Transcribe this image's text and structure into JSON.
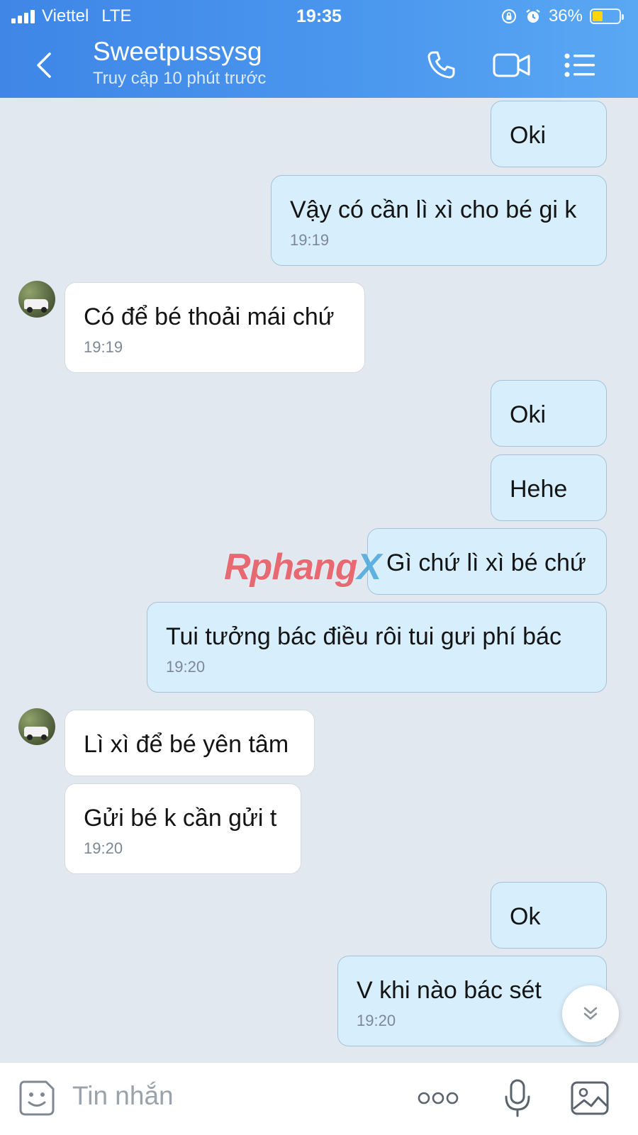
{
  "status_bar": {
    "carrier": "Viettel",
    "network": "LTE",
    "time": "19:35",
    "battery": "36%"
  },
  "header": {
    "contact_name": "Sweetpussysg",
    "last_seen": "Truy cập 10 phút trước"
  },
  "messages": [
    {
      "direction": "sent",
      "text": "Oki",
      "time": ""
    },
    {
      "direction": "sent",
      "text": "Vậy có cần lì xì cho bé gi k",
      "time": "19:19"
    },
    {
      "direction": "received",
      "text": "Có để bé thoải mái chứ",
      "time": "19:19"
    },
    {
      "direction": "sent",
      "text": "Oki",
      "time": ""
    },
    {
      "direction": "sent",
      "text": "Hehe",
      "time": ""
    },
    {
      "direction": "sent",
      "text": "Gì chứ lì xì bé chứ",
      "time": ""
    },
    {
      "direction": "sent",
      "text": "Tui tưởng bác điều rôi tui gưi phí bác",
      "time": "19:20"
    },
    {
      "direction": "received",
      "text": "Lì xì để bé yên tâm",
      "time": ""
    },
    {
      "direction": "received",
      "text": "Gửi bé k cần gửi t",
      "time": "19:20"
    },
    {
      "direction": "sent",
      "text": "Ok",
      "time": ""
    },
    {
      "direction": "sent",
      "text": "V khi nào bác sét",
      "time": "19:20"
    }
  ],
  "watermark": {
    "main": "Rphang",
    "end": "X"
  },
  "composer": {
    "placeholder": "Tin nhắn"
  },
  "icons": {
    "back": "chevron-left-icon",
    "call": "phone-icon",
    "video": "video-camera-icon",
    "menu": "list-menu-icon",
    "sticker": "sticker-face-icon",
    "more": "more-dots-icon",
    "mic": "microphone-icon",
    "image": "image-gallery-icon",
    "scroll": "double-chevron-down-icon"
  },
  "colors": {
    "header": "#4b98ef",
    "sent_bubble": "#d7eefc",
    "received_bubble": "#ffffff",
    "chat_background": "#e2e8f0"
  }
}
